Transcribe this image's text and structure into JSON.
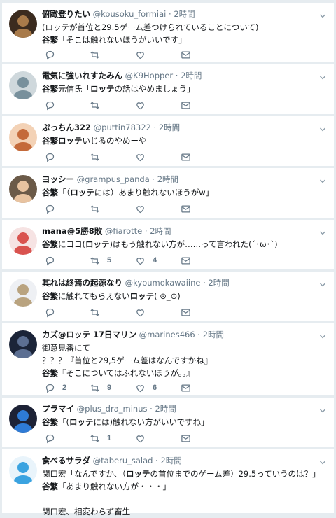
{
  "tweets": [
    {
      "name": "俯瞰登りたい",
      "handle": "@kousoku_formiai",
      "dot": "·",
      "time": "2時間",
      "lines": [
        [
          {
            "t": "(ロッテが首位と29.5ゲーム差つけられていることについて)",
            "b": false
          }
        ],
        [
          {
            "t": "谷繁",
            "b": true
          },
          {
            "t": "「そこは触れないほうがいいです」",
            "b": false
          }
        ]
      ],
      "reply_count": "",
      "retweet_count": "",
      "like_count": ""
    },
    {
      "name": "電気に強いれすたみん",
      "handle": "@K9Hopper",
      "dot": "·",
      "time": "2時間",
      "lines": [
        [
          {
            "t": "谷繁",
            "b": true
          },
          {
            "t": "元信氏「",
            "b": false
          },
          {
            "t": "ロッテ",
            "b": true
          },
          {
            "t": "の話はやめましょう」",
            "b": false
          }
        ]
      ],
      "reply_count": "",
      "retweet_count": "",
      "like_count": ""
    },
    {
      "name": "ぷっちん322",
      "handle": "@puttin78322",
      "dot": "·",
      "time": "2時間",
      "lines": [
        [
          {
            "t": "谷繁",
            "b": true
          },
          {
            "t": "ロッテ",
            "b": true
          },
          {
            "t": "いじるのやめーや",
            "b": false
          }
        ]
      ],
      "reply_count": "",
      "retweet_count": "",
      "like_count": ""
    },
    {
      "name": "ヨッシー",
      "handle": "@grampus_panda",
      "dot": "·",
      "time": "2時間",
      "lines": [
        [
          {
            "t": "谷繁",
            "b": true
          },
          {
            "t": "「（",
            "b": false
          },
          {
            "t": "ロッテ",
            "b": true
          },
          {
            "t": "には）あまり触れないほうがw」",
            "b": false
          }
        ]
      ],
      "reply_count": "",
      "retweet_count": "",
      "like_count": ""
    },
    {
      "name": "mana@5勝8敗",
      "handle": "@fiarotte",
      "dot": "·",
      "time": "2時間",
      "lines": [
        [
          {
            "t": "谷繁",
            "b": true
          },
          {
            "t": "にココ(",
            "b": false
          },
          {
            "t": "ロッテ",
            "b": true
          },
          {
            "t": ")はもう触れない方が……って言われた(´･ω･`)",
            "b": false
          }
        ]
      ],
      "reply_count": "",
      "retweet_count": "5",
      "like_count": "4"
    },
    {
      "name": "其れは終焉の起源なり",
      "handle": "@kyoumokawaiine",
      "dot": "·",
      "time": "2時間",
      "lines": [
        [
          {
            "t": "谷繁",
            "b": true
          },
          {
            "t": "に触れてもらえない",
            "b": false
          },
          {
            "t": "ロッテ",
            "b": true
          },
          {
            "t": "( ⊙_⊙)",
            "b": false
          }
        ]
      ],
      "reply_count": "",
      "retweet_count": "",
      "like_count": ""
    },
    {
      "name": "カズ@ロッテ 17日マリン",
      "handle": "@marines466",
      "dot": "·",
      "time": "2時間",
      "lines": [
        [
          {
            "t": "御意見番にて",
            "b": false
          }
        ],
        [
          {
            "t": "？？？『首位と29,5ゲーム差はなんですかね』",
            "b": false
          }
        ],
        [
          {
            "t": "谷繁",
            "b": true
          },
          {
            "t": "『そこについてはふれないほうが。。』",
            "b": false
          }
        ]
      ],
      "reply_count": "2",
      "retweet_count": "9",
      "like_count": "6"
    },
    {
      "name": "プラマイ",
      "handle": "@plus_dra_minus",
      "dot": "·",
      "time": "2時間",
      "lines": [
        [
          {
            "t": "谷繁",
            "b": true
          },
          {
            "t": "「(",
            "b": false
          },
          {
            "t": "ロッテ",
            "b": true
          },
          {
            "t": "には)触れない方がいいですね」",
            "b": false
          }
        ]
      ],
      "reply_count": "",
      "retweet_count": "1",
      "like_count": ""
    },
    {
      "name": "食べるサラダ",
      "handle": "@taberu_salad",
      "dot": "·",
      "time": "2時間",
      "lines": [
        [
          {
            "t": "関口宏「なんですか、（",
            "b": false
          },
          {
            "t": "ロッテ",
            "b": true
          },
          {
            "t": "の首位までのゲーム差）29.5っていうのは？」",
            "b": false
          }
        ],
        [
          {
            "t": "谷繁",
            "b": true
          },
          {
            "t": "「あまり触れない方が・・・」",
            "b": false
          }
        ],
        [
          {
            "t": "",
            "b": false
          }
        ],
        [
          {
            "t": "関口宏、相変わらず畜生",
            "b": false
          }
        ]
      ],
      "reply_count": "",
      "retweet_count": "",
      "like_count": ""
    }
  ],
  "icons": {
    "reply": "reply-icon",
    "retweet": "retweet-icon",
    "like": "heart-icon",
    "dm": "envelope-icon",
    "menu": "chevron-down-icon"
  },
  "colors": {
    "background": "#e6ecf0",
    "card": "#ffffff",
    "meta": "#657786",
    "icon": "#657786"
  }
}
